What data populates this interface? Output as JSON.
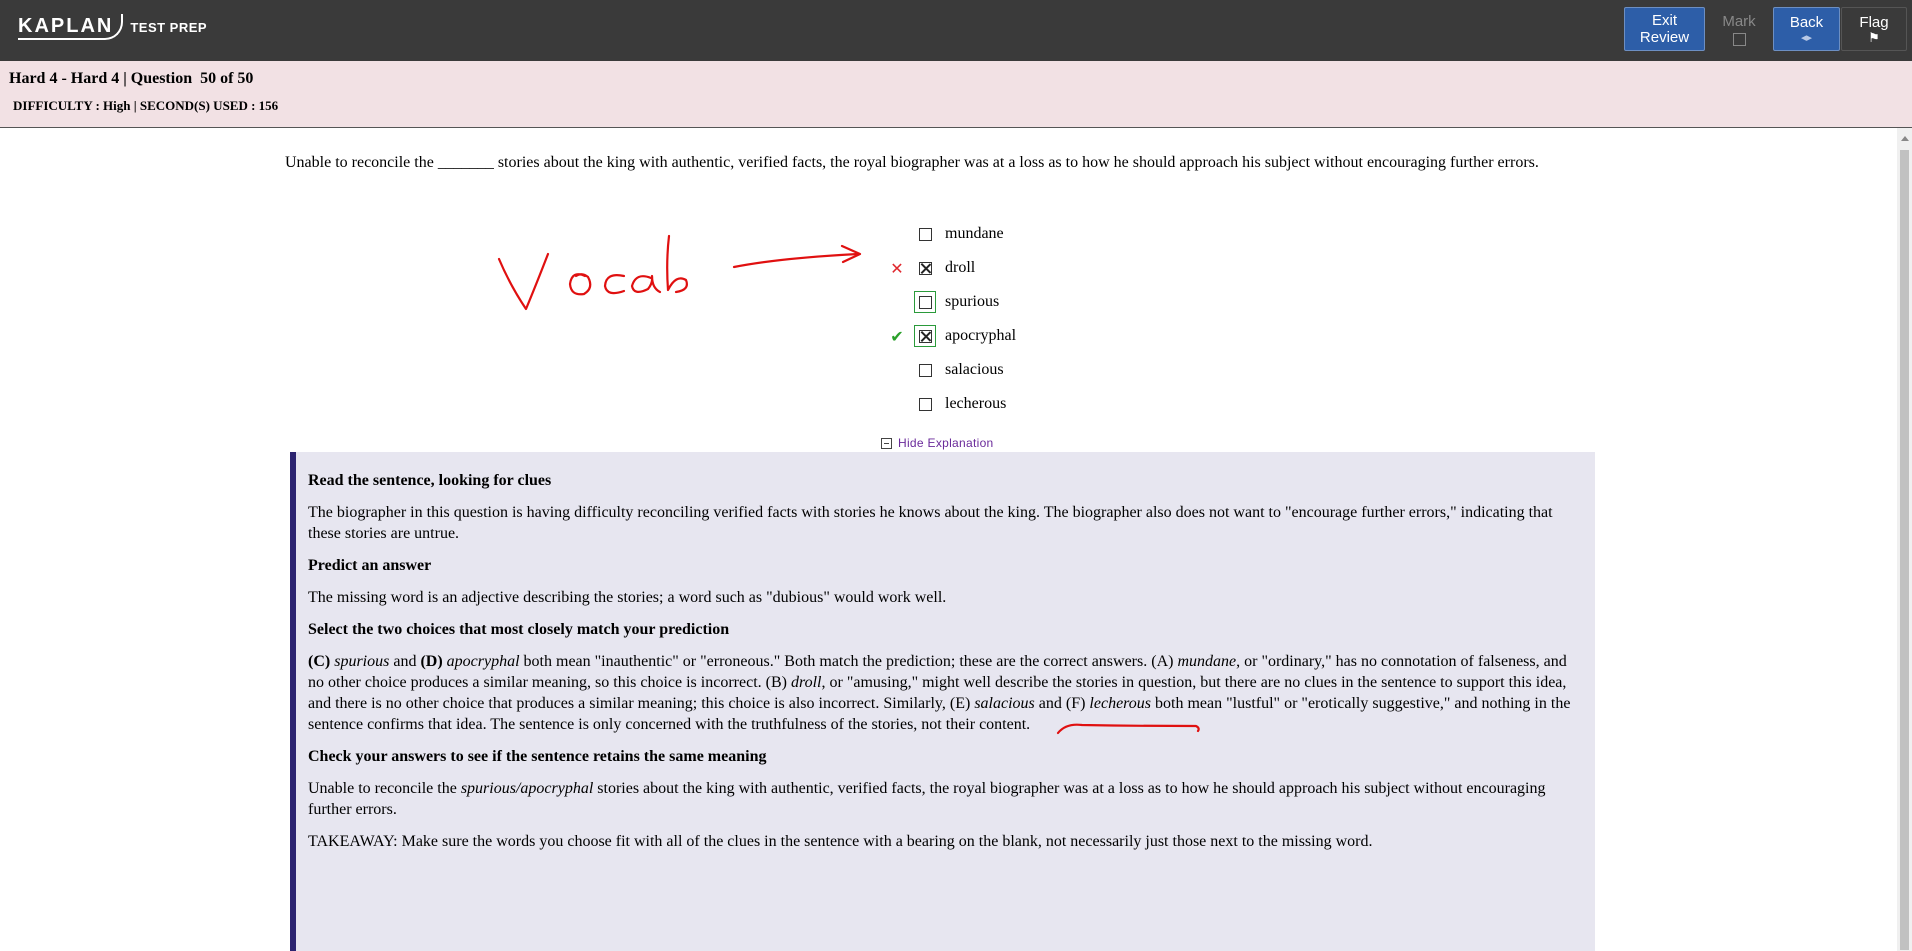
{
  "header": {
    "logo_text": "KAPLAN",
    "logo_sub": "TEST PREP",
    "buttons": {
      "exit_line1": "Exit",
      "exit_line2": "Review",
      "mark": "Mark",
      "back": "Back",
      "back_glyph": "◂▸",
      "flag": "Flag",
      "flag_glyph": "⚑"
    }
  },
  "info": {
    "title": "Hard 4 - Hard 4 | Question  50 of 50",
    "meta": "DIFFICULTY : High | SECOND(S) USED : 156"
  },
  "question": {
    "stem": "Unable to reconcile the _______ stories about the king with authentic, verified facts, the royal biographer was at a loss as to how he should approach his subject without encouraging further errors.",
    "choices": [
      {
        "label": "mundane",
        "checked": false,
        "result": ""
      },
      {
        "label": "droll",
        "checked": true,
        "result": "✕"
      },
      {
        "label": "spurious",
        "checked": false,
        "result": ""
      },
      {
        "label": "apocryphal",
        "checked": true,
        "result": "✔"
      },
      {
        "label": "salacious",
        "checked": false,
        "result": ""
      },
      {
        "label": "lecherous",
        "checked": false,
        "result": ""
      }
    ],
    "hide_explanation": "Hide Explanation"
  },
  "explanation": {
    "h1": "Read the sentence, looking for clues",
    "p1": "The biographer in this question is having difficulty reconciling verified facts with stories he knows about the king. The biographer also does not want to \"encourage further errors,\" indicating that these stories are untrue.",
    "h2": "Predict an answer",
    "p2": "The missing word is an adjective describing the stories; a word such as \"dubious\" would work well.",
    "h3": "Select the two choices that most closely match your prediction",
    "p3": {
      "c_label": "(C)",
      "c_word": "spurious",
      "and1": " and ",
      "d_label": "(D)",
      "d_word": "apocryphal",
      "t1": " both mean \"inauthentic\" or \"erroneous.\" Both match the prediction; these are the correct answers. (A) ",
      "a_word": "mundane",
      "t2": ", or \"ordinary,\" has no connotation of falseness, and no other choice produces a similar meaning, so this choice is incorrect. (B) ",
      "b_word": "droll",
      "t3": ", or \"amusing,\" might well describe the stories in question, but there are no clues in the sentence to support this idea, and there is no other choice that produces a similar meaning; this choice is also incorrect. Similarly, (E) ",
      "e_word": "salacious",
      "and2": " and (F) ",
      "f_word": "lecherous",
      "t4": " both mean \"lustful\" or \"erotically suggestive,\" and nothing in the sentence confirms that idea. The sentence is only concerned with the truthfulness of the stories, not their content."
    },
    "h4": "Check your answers to see if the sentence retains the same meaning",
    "p4": {
      "pre": "Unable to reconcile the ",
      "words": "spurious/apocryphal",
      "post": " stories about the king with authentic, verified facts, the royal biographer was at a loss as to how he should approach his subject without encouraging further errors."
    },
    "p5": "TAKEAWAY: Make sure the words you choose fit with all of the clues in the sentence with a bearing on the blank, not necessarily just those next to the missing word."
  },
  "annotation": {
    "handwriting": "Vocab",
    "ink_color": "#e01010"
  },
  "colors": {
    "topbar": "#3a3a3a",
    "infobar": "#f2e1e4",
    "explanation_bg": "#e7e6f0",
    "explanation_border": "#2c2470",
    "correct": "#2aa02a",
    "incorrect": "#e0282e",
    "button_blue": "#2d5ea8"
  }
}
